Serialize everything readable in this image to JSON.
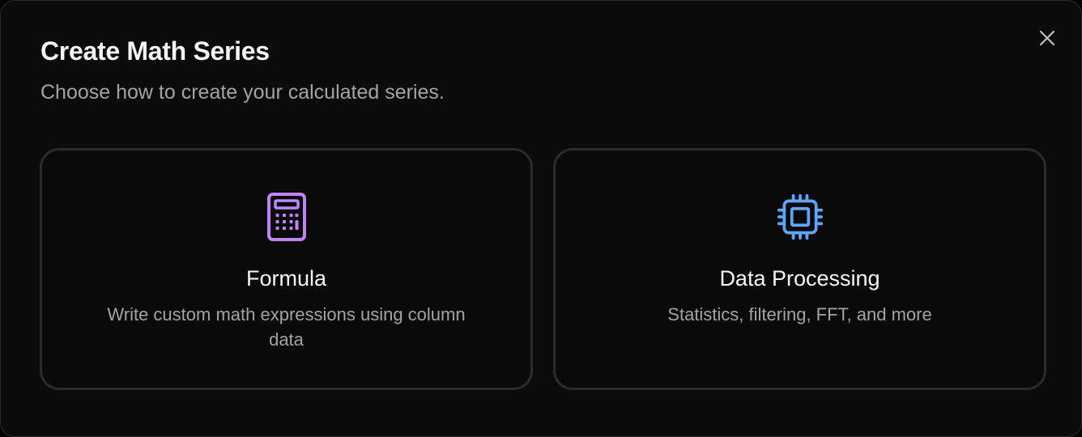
{
  "dialog": {
    "title": "Create Math Series",
    "subtitle": "Choose how to create your calculated series.",
    "close_icon": "close-icon"
  },
  "options": [
    {
      "title": "Formula",
      "description": "Write custom math expressions using column data",
      "icon": "calculator-icon",
      "accent": "#c084fc"
    },
    {
      "title": "Data Processing",
      "description": "Statistics, filtering, FFT, and more",
      "icon": "cpu-chip-icon",
      "accent": "#60a5fa"
    }
  ],
  "colors": {
    "background": "#0b0b0b",
    "card_border": "#2b2b2b",
    "text_primary": "#f5f5f5",
    "text_secondary": "#a3a3a3"
  }
}
